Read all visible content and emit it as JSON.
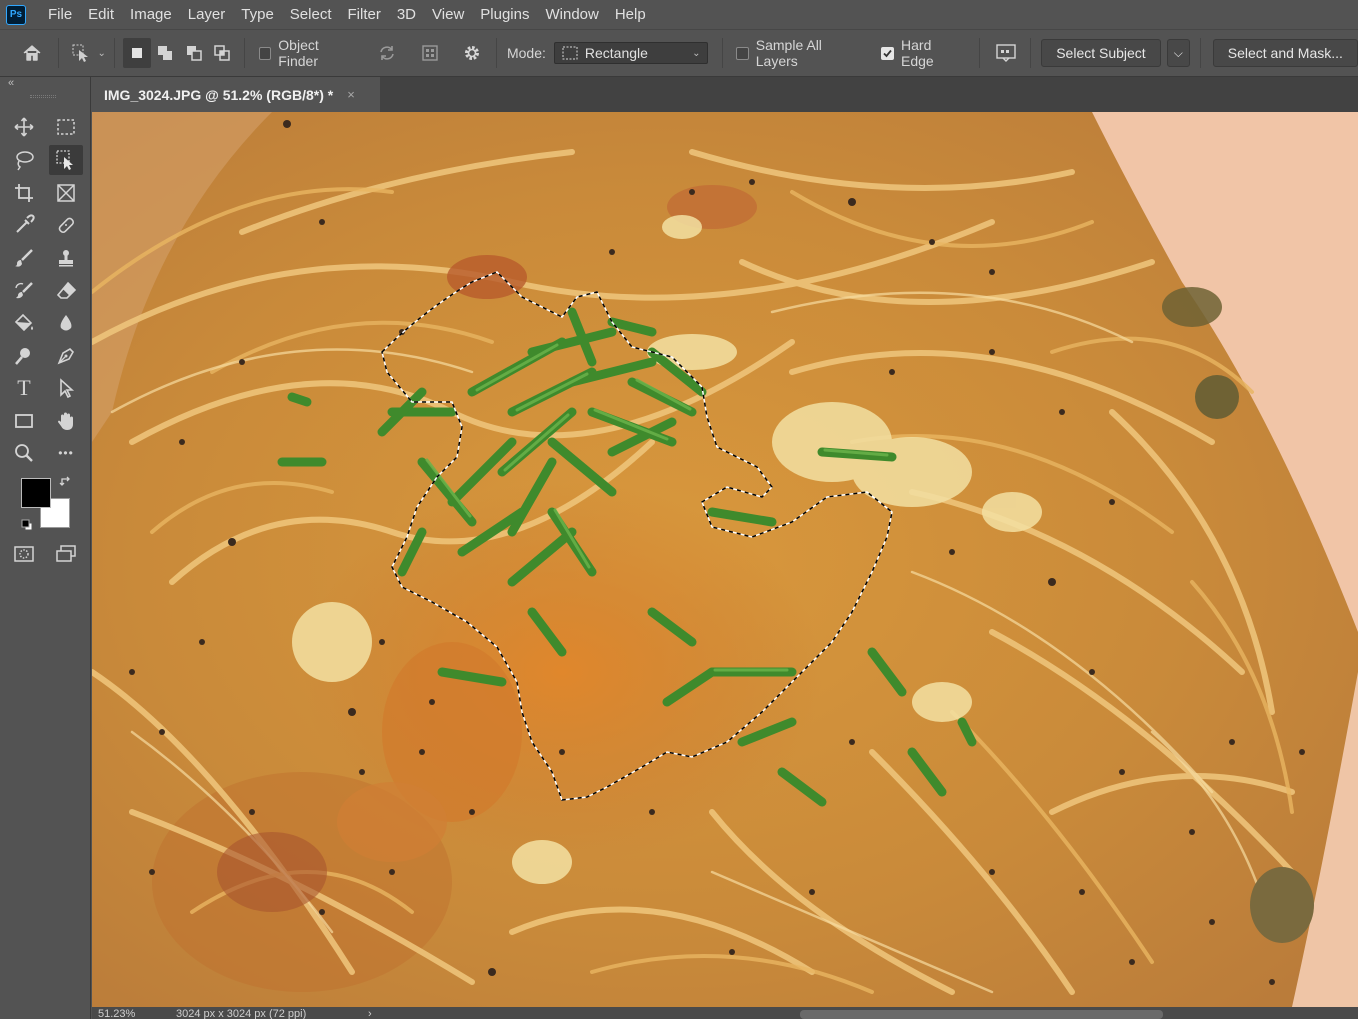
{
  "app": {
    "logo": "Ps"
  },
  "menu": [
    "File",
    "Edit",
    "Image",
    "Layer",
    "Type",
    "Select",
    "Filter",
    "3D",
    "View",
    "Plugins",
    "Window",
    "Help"
  ],
  "options": {
    "object_finder": "Object Finder",
    "object_finder_checked": false,
    "mode_label": "Mode:",
    "mode_value": "Rectangle",
    "sample_all_layers": "Sample All Layers",
    "sample_all_layers_checked": false,
    "hard_edge": "Hard Edge",
    "hard_edge_checked": true,
    "select_subject": "Select Subject",
    "select_and_mask": "Select and Mask..."
  },
  "document": {
    "tab_title": "IMG_3024.JPG @ 51.2% (RGB/8*) *",
    "close_glyph": "×"
  },
  "colors": {
    "foreground": "#000000",
    "background": "#ffffff",
    "ui_bg": "#535353"
  },
  "tools": [
    {
      "name": "move-tool-icon"
    },
    {
      "name": "rectangular-marquee-tool-icon"
    },
    {
      "name": "lasso-tool-icon"
    },
    {
      "name": "object-selection-tool-icon",
      "active": true
    },
    {
      "name": "crop-tool-icon"
    },
    {
      "name": "frame-tool-icon"
    },
    {
      "name": "eyedropper-tool-icon"
    },
    {
      "name": "healing-brush-tool-icon"
    },
    {
      "name": "brush-tool-icon"
    },
    {
      "name": "clone-stamp-tool-icon"
    },
    {
      "name": "history-brush-tool-icon"
    },
    {
      "name": "eraser-tool-icon"
    },
    {
      "name": "paint-bucket-tool-icon"
    },
    {
      "name": "blur-tool-icon"
    },
    {
      "name": "dodge-tool-icon"
    },
    {
      "name": "pen-tool-icon"
    },
    {
      "name": "type-tool-icon"
    },
    {
      "name": "path-selection-tool-icon"
    },
    {
      "name": "rectangle-tool-icon"
    },
    {
      "name": "hand-tool-icon"
    },
    {
      "name": "zoom-tool-icon"
    },
    {
      "name": "more-tools-icon"
    }
  ],
  "tool_text": {
    "type": "T",
    "more": "•••"
  },
  "status": {
    "zoom": "51.23%",
    "doc_info": "3024 px x 3024 px (72 ppi)",
    "arrow": "›"
  }
}
